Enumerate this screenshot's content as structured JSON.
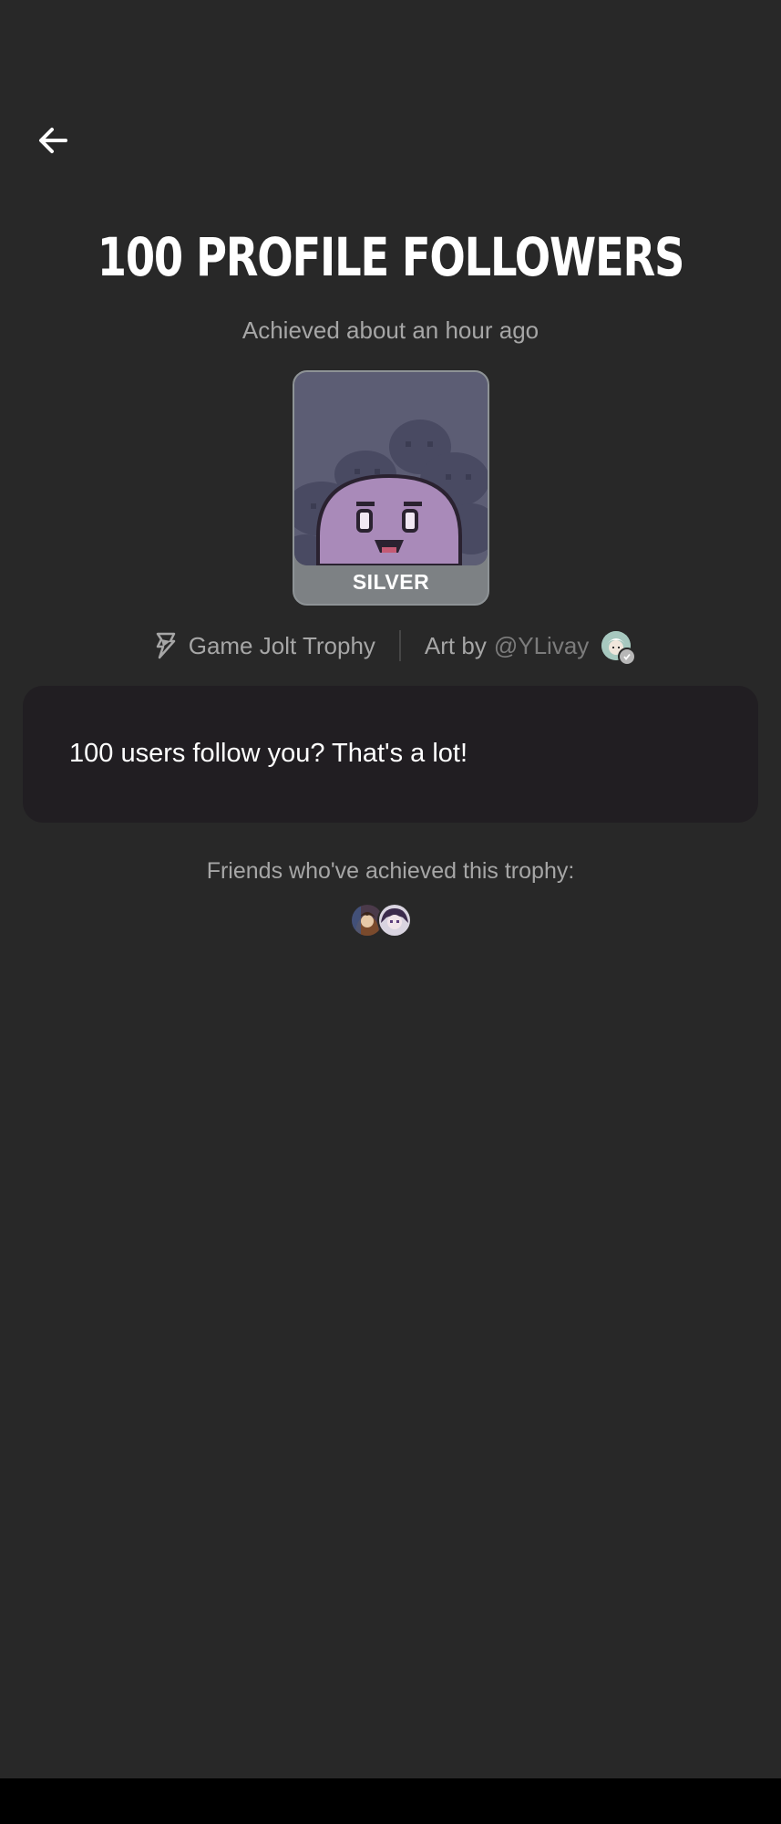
{
  "header": {
    "back_icon": "arrow-left-icon"
  },
  "trophy": {
    "title": "100 PROFILE FOLLOWERS",
    "achieved": "Achieved about an hour ago",
    "tier": "SILVER",
    "source_icon": "game-jolt-bolt-icon",
    "source": "Game Jolt Trophy",
    "art_by_prefix": "Art by",
    "artist_handle": "@YLivay",
    "description": "100 users follow you? That's a lot!"
  },
  "friends": {
    "label": "Friends who've achieved this trophy:",
    "count_shown": 2
  },
  "colors": {
    "background": "#282828",
    "card": "#211e22",
    "muted_text": "#a6a6a6",
    "tier_silver": "#7d8184"
  }
}
